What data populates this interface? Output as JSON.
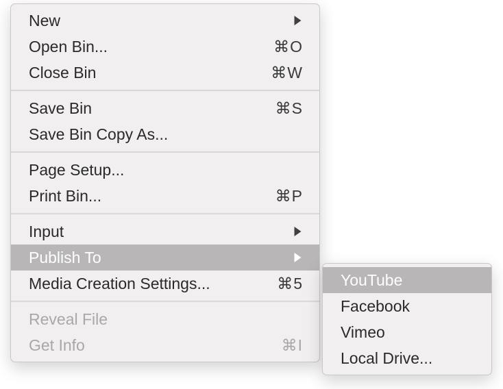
{
  "main_menu": {
    "groups": [
      [
        {
          "label": "New",
          "shortcut": "",
          "has_submenu": true,
          "highlight": false,
          "disabled": false,
          "name": "menu-item-new"
        },
        {
          "label": "Open Bin...",
          "shortcut": "⌘O",
          "has_submenu": false,
          "highlight": false,
          "disabled": false,
          "name": "menu-item-open-bin"
        },
        {
          "label": "Close Bin",
          "shortcut": "⌘W",
          "has_submenu": false,
          "highlight": false,
          "disabled": false,
          "name": "menu-item-close-bin"
        }
      ],
      [
        {
          "label": "Save Bin",
          "shortcut": "⌘S",
          "has_submenu": false,
          "highlight": false,
          "disabled": false,
          "name": "menu-item-save-bin"
        },
        {
          "label": "Save Bin Copy As...",
          "shortcut": "",
          "has_submenu": false,
          "highlight": false,
          "disabled": false,
          "name": "menu-item-save-bin-copy-as"
        }
      ],
      [
        {
          "label": "Page Setup...",
          "shortcut": "",
          "has_submenu": false,
          "highlight": false,
          "disabled": false,
          "name": "menu-item-page-setup"
        },
        {
          "label": "Print Bin...",
          "shortcut": "⌘P",
          "has_submenu": false,
          "highlight": false,
          "disabled": false,
          "name": "menu-item-print-bin"
        }
      ],
      [
        {
          "label": "Input",
          "shortcut": "",
          "has_submenu": true,
          "highlight": false,
          "disabled": false,
          "name": "menu-item-input"
        },
        {
          "label": "Publish To",
          "shortcut": "",
          "has_submenu": true,
          "highlight": true,
          "disabled": false,
          "name": "menu-item-publish-to"
        },
        {
          "label": "Media Creation Settings...",
          "shortcut": "⌘5",
          "has_submenu": false,
          "highlight": false,
          "disabled": false,
          "name": "menu-item-media-creation-settings"
        }
      ],
      [
        {
          "label": "Reveal File",
          "shortcut": "",
          "has_submenu": false,
          "highlight": false,
          "disabled": true,
          "name": "menu-item-reveal-file"
        },
        {
          "label": "Get Info",
          "shortcut": "⌘I",
          "has_submenu": false,
          "highlight": false,
          "disabled": true,
          "name": "menu-item-get-info"
        }
      ]
    ]
  },
  "sub_menu": {
    "items": [
      {
        "label": "YouTube",
        "highlight": true,
        "name": "submenu-item-youtube"
      },
      {
        "label": "Facebook",
        "highlight": false,
        "name": "submenu-item-facebook"
      },
      {
        "label": "Vimeo",
        "highlight": false,
        "name": "submenu-item-vimeo"
      },
      {
        "label": "Local Drive...",
        "highlight": false,
        "name": "submenu-item-local-drive"
      }
    ]
  }
}
